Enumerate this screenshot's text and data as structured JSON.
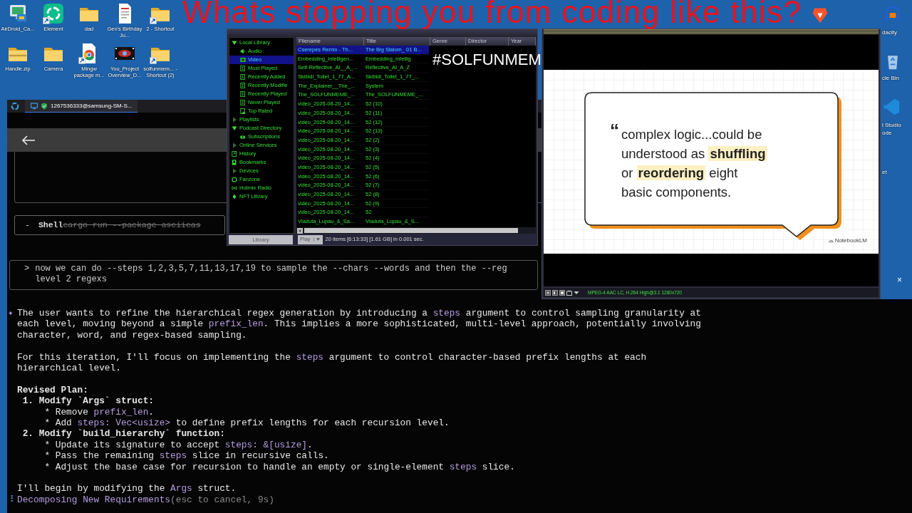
{
  "desktop": {
    "icons": [
      {
        "label": "AirDroid_Ca...",
        "kind": "monitor",
        "shortcut": false
      },
      {
        "label": "Element",
        "kind": "ring",
        "shortcut": true
      },
      {
        "label": "dad",
        "kind": "folder",
        "shortcut": false
      },
      {
        "label": "Gen's Birthday Ju...",
        "kind": "document",
        "shortcut": false
      },
      {
        "label": "2 - Shortcut",
        "kind": "folder",
        "shortcut": true
      },
      {
        "label": "Handle.zip",
        "kind": "zip",
        "shortcut": false
      },
      {
        "label": "Camera",
        "kind": "folder",
        "shortcut": false
      },
      {
        "label": "Mingw package m...",
        "kind": "browser",
        "shortcut": true
      },
      {
        "label": "You_Project Overview_D...",
        "kind": "film",
        "shortcut": false
      },
      {
        "label": "solfunmem... - Shortcut (2)",
        "kind": "folder",
        "shortcut": true
      }
    ],
    "edge_labels": [
      "dacity",
      "cle Bin",
      "l Studio",
      "ode",
      "et"
    ],
    "close_glyph": "×"
  },
  "caption": "Whats stopping you from coding like this?",
  "hashtag": "#SOLFUNMEM",
  "terminal": {
    "tab": {
      "title": "1267536333@samsung-SM-S..."
    },
    "tool_call": {
      "marker": "-",
      "name": "Shell",
      "command": "cargo run --package asciicas"
    },
    "prompt": {
      "marker": ">",
      "lines": [
        "now we can do --steps 1,2,3,5,7,11,13,17,19 to sample the --chars --words and then the --reg",
        "level 2 regexs"
      ]
    },
    "response": {
      "marker": "✦",
      "paragraphs": [
        {
          "lines": [
            {
              "bold": false,
              "segments": [
                {
                  "text": "The user wants to refine the hierarchical regex generation by introducing a ",
                  "code": false
                },
                {
                  "text": "steps",
                  "code": true
                },
                {
                  "text": " argument to control sampling granularity at",
                  "code": false
                }
              ]
            },
            {
              "bold": false,
              "segments": [
                {
                  "text": "each level, moving beyond a simple ",
                  "code": false
                },
                {
                  "text": "prefix_len",
                  "code": true
                },
                {
                  "text": ". This implies a more sophisticated, multi-level approach, potentially involving",
                  "code": false
                }
              ]
            },
            {
              "bold": false,
              "segments": [
                {
                  "text": "character, word, and regex-based sampling.",
                  "code": false
                }
              ]
            }
          ]
        },
        {
          "lines": [
            {
              "bold": false,
              "segments": [
                {
                  "text": "For this iteration, I'll focus on implementing the ",
                  "code": false
                },
                {
                  "text": "steps",
                  "code": true
                },
                {
                  "text": " argument to control character-based prefix lengths at each",
                  "code": false
                }
              ]
            },
            {
              "bold": false,
              "segments": [
                {
                  "text": "hierarchical level.",
                  "code": false
                }
              ]
            }
          ]
        },
        {
          "lines": [
            {
              "bold": true,
              "segments": [
                {
                  "text": "Revised Plan:",
                  "code": false
                }
              ]
            },
            {
              "bold": true,
              "segments": [
                {
                  "text": " 1. Modify `Args` struct:",
                  "code": false
                }
              ]
            },
            {
              "bold": false,
              "segments": [
                {
                  "text": "     * Remove ",
                  "code": false
                },
                {
                  "text": "prefix_len",
                  "code": true
                },
                {
                  "text": ".",
                  "code": false
                }
              ]
            },
            {
              "bold": false,
              "segments": [
                {
                  "text": "     * Add ",
                  "code": false
                },
                {
                  "text": "steps: Vec<usize>",
                  "code": true
                },
                {
                  "text": " to define prefix lengths for each recursion level.",
                  "code": false
                }
              ]
            },
            {
              "bold": true,
              "segments": [
                {
                  "text": " 2. Modify `build_hierarchy` function:",
                  "code": false
                }
              ]
            },
            {
              "bold": false,
              "segments": [
                {
                  "text": "     * Update its signature to accept ",
                  "code": false
                },
                {
                  "text": "steps: &[usize]",
                  "code": true
                },
                {
                  "text": ".",
                  "code": false
                }
              ]
            },
            {
              "bold": false,
              "segments": [
                {
                  "text": "     * Pass the remaining ",
                  "code": false
                },
                {
                  "text": "steps",
                  "code": true
                },
                {
                  "text": " slice in recursive calls.",
                  "code": false
                }
              ]
            },
            {
              "bold": false,
              "segments": [
                {
                  "text": "     * Adjust the base case for recursion to handle an empty or single-element ",
                  "code": false
                },
                {
                  "text": "steps",
                  "code": true
                },
                {
                  "text": " slice.",
                  "code": false
                }
              ]
            }
          ]
        },
        {
          "lines": [
            {
              "bold": false,
              "segments": [
                {
                  "text": "I'll begin by modifying the ",
                  "code": false
                },
                {
                  "text": "Args",
                  "code": true
                },
                {
                  "text": " struct.",
                  "code": false
                }
              ]
            }
          ]
        }
      ]
    },
    "status": {
      "spinner": "⠸",
      "text": "Decomposing New Requirements",
      "hint": "(esc to cancel, 9s)"
    }
  },
  "media_library": {
    "tree": [
      {
        "label": "Local Library",
        "expanded": true,
        "selected": false,
        "children": [
          {
            "label": "Audio",
            "kind": "audio",
            "selected": false
          },
          {
            "label": "Video",
            "kind": "video",
            "selected": true
          },
          {
            "label": "Most Played",
            "kind": "view",
            "selected": false
          },
          {
            "label": "Recently Added",
            "kind": "view",
            "selected": false
          },
          {
            "label": "Recently Modifie",
            "kind": "view",
            "selected": false
          },
          {
            "label": "Recently Played",
            "kind": "view",
            "selected": false
          },
          {
            "label": "Never Played",
            "kind": "view",
            "selected": false
          },
          {
            "label": "Top Rated",
            "kind": "star",
            "selected": false
          }
        ]
      },
      {
        "label": "Playlists",
        "expanded": false,
        "selected": false
      },
      {
        "label": "Podcast Directory",
        "expanded": true,
        "selected": false,
        "children": [
          {
            "label": "Subscriptions",
            "kind": "feed",
            "selected": false
          }
        ]
      },
      {
        "label": "Online Services",
        "expanded": false,
        "selected": false
      },
      {
        "label": "History",
        "kind": "history",
        "selected": false
      },
      {
        "label": "Bookmarks",
        "kind": "bookmark",
        "selected": false
      },
      {
        "label": "Devices",
        "expanded": false,
        "selected": false
      },
      {
        "label": "Fanzone",
        "kind": "ring",
        "selected": false
      },
      {
        "label": "Hotmix Radio",
        "kind": "radio",
        "selected": false
      },
      {
        "label": "NFT Library",
        "kind": "nft",
        "selected": false
      }
    ],
    "columns": [
      "Filename",
      "Title",
      "Genre",
      "Director",
      "Year"
    ],
    "rows": [
      {
        "cells": [
          "Cserepes Remix - Th...",
          "The Big Slalom_ 01 B..."
        ],
        "selected": true
      },
      {
        "cells": [
          "Embedding_Intelligen...",
          "Embedding_Intellig"
        ],
        "selected": false
      },
      {
        "cells": [
          "Self-Reflective_AI__A_...",
          "Reflective_AI_A_Z"
        ],
        "selected": false
      },
      {
        "cells": [
          "Skibidi_Toilet_1_77_A...",
          "Skibidi_Toilet_1_77_..."
        ],
        "selected": false
      },
      {
        "cells": [
          "The_Explainer__The_...",
          "System"
        ],
        "selected": false
      },
      {
        "cells": [
          "The_SOLFUNMEME_...",
          "The_SOLFUNMEME_..."
        ],
        "selected": false
      },
      {
        "cells": [
          "video_2025-08-20_14...",
          "52 (10)"
        ],
        "selected": false
      },
      {
        "cells": [
          "video_2025-08-20_14...",
          "52 (11)"
        ],
        "selected": false
      },
      {
        "cells": [
          "video_2025-08-20_14...",
          "52 (12)"
        ],
        "selected": false
      },
      {
        "cells": [
          "video_2025-08-20_14...",
          "52 (13)"
        ],
        "selected": false
      },
      {
        "cells": [
          "video_2025-08-20_14...",
          "52 (2)"
        ],
        "selected": false
      },
      {
        "cells": [
          "video_2025-08-20_14...",
          "52 (3)"
        ],
        "selected": false
      },
      {
        "cells": [
          "video_2025-08-20_14...",
          "52 (4)"
        ],
        "selected": false
      },
      {
        "cells": [
          "video_2025-08-20_14...",
          "52 (5)"
        ],
        "selected": false
      },
      {
        "cells": [
          "video_2025-08-20_14...",
          "52 (6)"
        ],
        "selected": false
      },
      {
        "cells": [
          "video_2025-08-20_14...",
          "52 (7)"
        ],
        "selected": false
      },
      {
        "cells": [
          "video_2025-08-20_14...",
          "52 (8)"
        ],
        "selected": false
      },
      {
        "cells": [
          "video_2025-08-20_14...",
          "52 (9)"
        ],
        "selected": false
      },
      {
        "cells": [
          "video_2025-08-20_14...",
          "52"
        ],
        "selected": false
      },
      {
        "cells": [
          "Vladuta_Lupau_&_Sa...",
          "Vladuta_Lupau_&_S..."
        ],
        "selected": false
      }
    ],
    "library_button": "Library",
    "play_button": "Play",
    "status": "20 items [6:13:33] [1.61 GB] in 0.001 sec."
  },
  "video_window": {
    "slide": {
      "quote_mark": "“",
      "quote_lines": [
        "complex logic...could be",
        "understood as **shuffling**",
        "or **reordering** eight",
        "basic components."
      ],
      "brand": "NotebookLM"
    },
    "status": "MPEG-4 AAC LC, H.264 High@3.1 1280x720"
  }
}
